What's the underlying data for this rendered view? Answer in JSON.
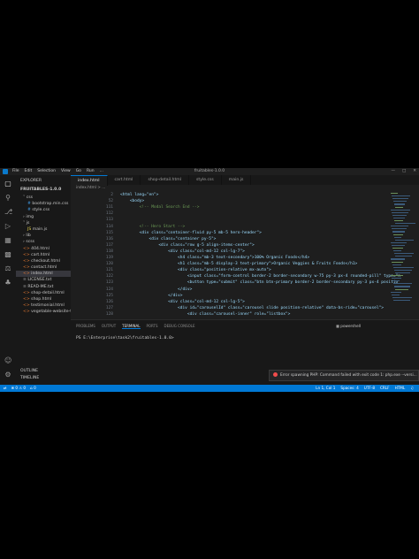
{
  "window": {
    "title": "fruitables-1.0.0",
    "menu": [
      "File",
      "Edit",
      "Selection",
      "View",
      "Go",
      "Run",
      "..."
    ],
    "controls": [
      "—",
      "□",
      "✕"
    ]
  },
  "sidebar": {
    "header": "EXPLORER",
    "project": "FRUITABLES-1.0.0",
    "items": [
      {
        "label": "css",
        "indent": 1,
        "icon": "chevron-down-icon"
      },
      {
        "label": "bootstrap.min.css",
        "indent": 2,
        "icon": "css-file-icon"
      },
      {
        "label": "style.css",
        "indent": 2,
        "icon": "css-file-icon"
      },
      {
        "label": "img",
        "indent": 1,
        "icon": "chevron-right-icon"
      },
      {
        "label": "js",
        "indent": 1,
        "icon": "chevron-down-icon"
      },
      {
        "label": "main.js",
        "indent": 2,
        "icon": "js-file-icon"
      },
      {
        "label": "lib",
        "indent": 1,
        "icon": "chevron-right-icon"
      },
      {
        "label": "scss",
        "indent": 1,
        "icon": "chevron-right-icon"
      },
      {
        "label": "404.html",
        "indent": 1,
        "icon": "html-file-icon"
      },
      {
        "label": "cart.html",
        "indent": 1,
        "icon": "html-file-icon"
      },
      {
        "label": "checkout.html",
        "indent": 1,
        "icon": "html-file-icon"
      },
      {
        "label": "contact.html",
        "indent": 1,
        "icon": "html-file-icon"
      },
      {
        "label": "index.html",
        "indent": 1,
        "icon": "html-file-icon",
        "selected": true
      },
      {
        "label": "LICENSE.txt",
        "indent": 1,
        "icon": "text-file-icon"
      },
      {
        "label": "READ-ME.txt",
        "indent": 1,
        "icon": "text-file-icon"
      },
      {
        "label": "shop-detail.html",
        "indent": 1,
        "icon": "html-file-icon"
      },
      {
        "label": "shop.html",
        "indent": 1,
        "icon": "html-file-icon"
      },
      {
        "label": "testimonial.html",
        "indent": 1,
        "icon": "html-file-icon"
      },
      {
        "label": "vegetable-website-te...",
        "indent": 1,
        "icon": "html-file-icon"
      }
    ],
    "outline": "OUTLINE",
    "timeline": "TIMELINE"
  },
  "tabs": [
    {
      "label": "index.html",
      "active": true
    },
    {
      "label": "cart.html",
      "active": false
    },
    {
      "label": "shop-detail.html",
      "active": false
    },
    {
      "label": "style.css",
      "active": false
    },
    {
      "label": "main.js",
      "active": false
    }
  ],
  "breadcrumb": "index.html > ...",
  "code": [
    {
      "n": "2",
      "t": "<html lang=\"en\">"
    },
    {
      "n": "52",
      "t": "    <body>"
    },
    {
      "n": "111",
      "t": "        <!-- Modal Search End -->"
    },
    {
      "n": "112",
      "t": ""
    },
    {
      "n": "113",
      "t": ""
    },
    {
      "n": "114",
      "t": "        <!-- Hero Start -->"
    },
    {
      "n": "115",
      "t": "        <div class=\"container-fluid py-5 mb-5 hero-header\">"
    },
    {
      "n": "116",
      "t": "            <div class=\"container py-5\">"
    },
    {
      "n": "117",
      "t": "                <div class=\"row g-5 align-items-center\">"
    },
    {
      "n": "118",
      "t": "                    <div class=\"col-md-12 col-lg-7\">"
    },
    {
      "n": "119",
      "t": "                        <h4 class=\"mb-3 text-secondary\">100% Organic Foods</h4>"
    },
    {
      "n": "120",
      "t": "                        <h1 class=\"mb-5 display-3 text-primary\">Organic Veggies & Fruits Foods</h1>"
    },
    {
      "n": "121",
      "t": "                        <div class=\"position-relative mx-auto\">"
    },
    {
      "n": "122",
      "t": "                            <input class=\"form-control border-2 border-secondary w-75 py-3 px-4 rounded-pill\" type=\"n"
    },
    {
      "n": "123",
      "t": "                            <button type=\"submit\" class=\"btn btn-primary border-2 border-secondary py-3 px-4 positio"
    },
    {
      "n": "124",
      "t": "                        </div>"
    },
    {
      "n": "125",
      "t": "                    </div>"
    },
    {
      "n": "126",
      "t": "                    <div class=\"col-md-12 col-lg-5\">"
    },
    {
      "n": "127",
      "t": "                        <div id=\"carouselId\" class=\"carousel slide position-relative\" data-bs-ride=\"carousel\">"
    },
    {
      "n": "128",
      "t": "                            <div class=\"carousel-inner\" role=\"listbox\">"
    }
  ],
  "panel": {
    "tabs": [
      "PROBLEMS",
      "OUTPUT",
      "TERMINAL",
      "PORTS",
      "DEBUG CONSOLE"
    ],
    "active_tab": "TERMINAL",
    "shell": "powershell",
    "prompt": "PS E:\\Enterprise\\task2\\fruitables-1.0.0>",
    "notification": "Error spawning PHP: Command failed with exit code 1: php.exe --versi..."
  },
  "status": {
    "left": [
      "⊗ 0 ⚠ 0",
      "⌂ 0"
    ],
    "right": [
      "Ln 1, Col 1",
      "Spaces: 4",
      "UTF-8",
      "CRLF",
      "HTML"
    ]
  },
  "colors": {
    "accent": "#0078d4",
    "error": "#f14c4c",
    "background": "#1e1e1e"
  }
}
